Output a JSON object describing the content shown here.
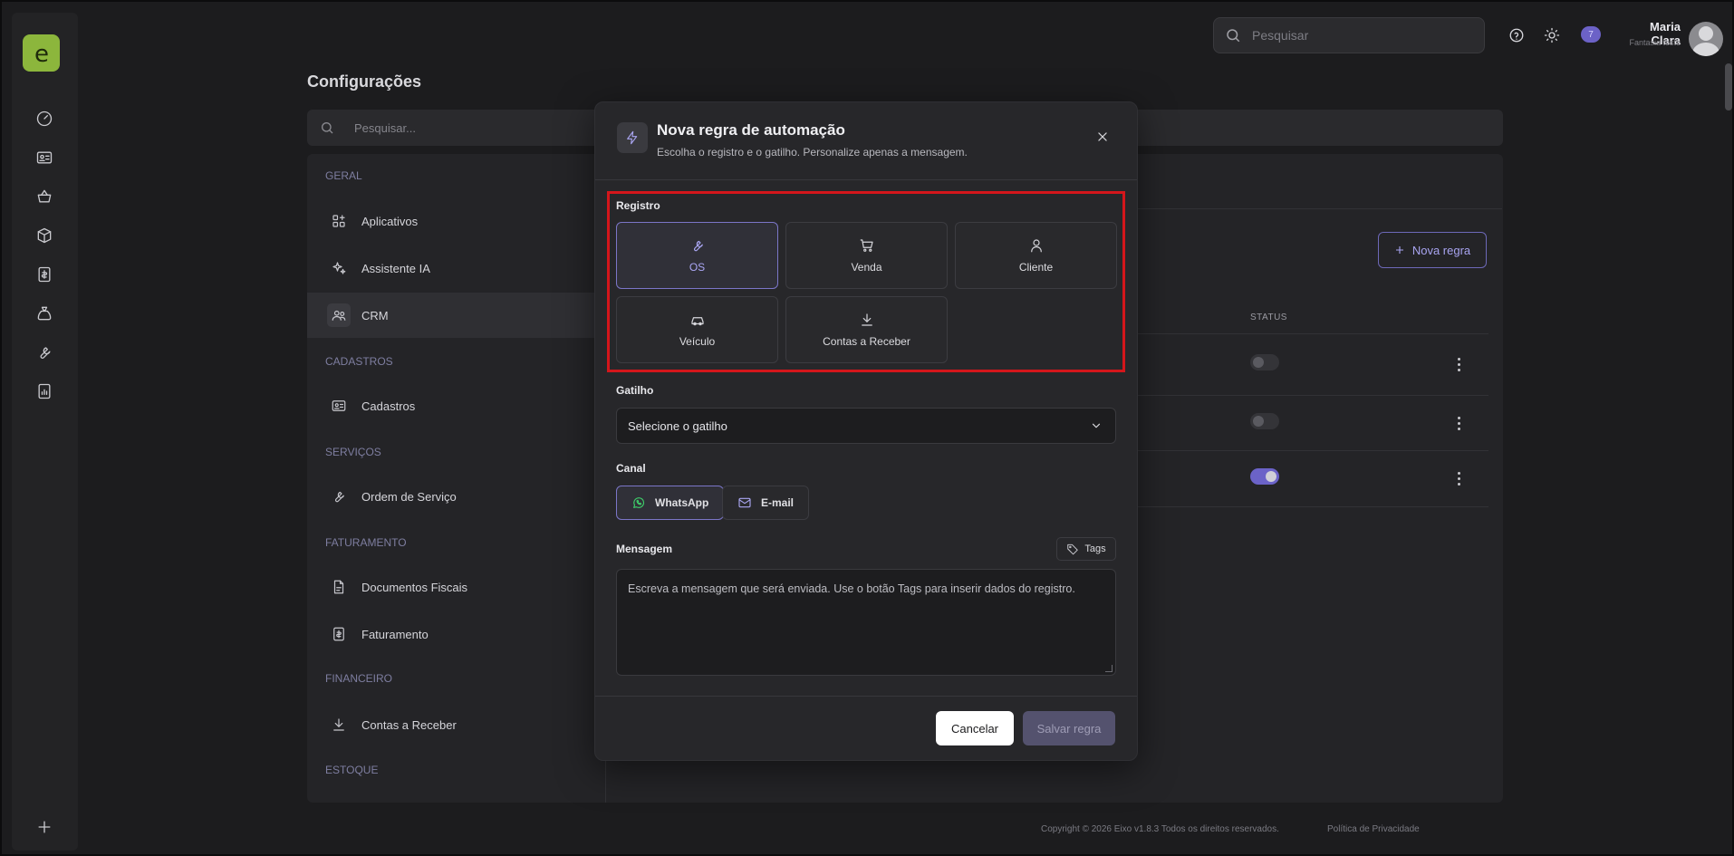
{
  "topbar": {
    "search_placeholder": "Pesquisar",
    "notifications_count": "7",
    "user_name": "Maria Clara",
    "user_company": "Fantasia teste"
  },
  "page": {
    "title": "Configurações",
    "search_placeholder": "Pesquisar..."
  },
  "sidebar": {
    "sections": {
      "geral": "GERAL",
      "cadastros": "CADASTROS",
      "servicos": "SERVIÇOS",
      "faturamento": "FATURAMENTO",
      "financeiro": "FINANCEIRO",
      "estoque": "ESTOQUE"
    },
    "items": {
      "aplicativos": "Aplicativos",
      "assistente": "Assistente IA",
      "crm": "CRM",
      "cadastros": "Cadastros",
      "ordem": "Ordem de Serviço",
      "documentos": "Documentos Fiscais",
      "faturamento": "Faturamento",
      "contas": "Contas a Receber"
    }
  },
  "rules": {
    "new_button": "Nova regra",
    "status_header": "STATUS",
    "rows": [
      {
        "status": "off"
      },
      {
        "status": "off"
      },
      {
        "status": "on"
      }
    ]
  },
  "footer": {
    "copyright": "Copyright © 2026 Eixo v1.8.3 Todos os direitos reservados.",
    "privacy": "Política de Privacidade"
  },
  "modal": {
    "title": "Nova regra de automação",
    "subtitle": "Escolha o registro e o gatilho. Personalize apenas a mensagem.",
    "registro_label": "Registro",
    "registro_options": {
      "os": "OS",
      "venda": "Venda",
      "cliente": "Cliente",
      "veiculo": "Veículo",
      "contas": "Contas a Receber"
    },
    "registro_selected": "OS",
    "gatilho_label": "Gatilho",
    "gatilho_value": "Selecione o gatilho",
    "canal_label": "Canal",
    "canal_whatsapp": "WhatsApp",
    "canal_email": "E-mail",
    "canal_selected": "WhatsApp",
    "mensagem_label": "Mensagem",
    "tags_button": "Tags",
    "mensagem_placeholder": "Escreva a mensagem que será enviada. Use o botão Tags para inserir dados do registro.",
    "cancel_button": "Cancelar",
    "save_button": "Salvar regra"
  },
  "colors": {
    "accent": "#6b63c8",
    "logo": "#8cb63c",
    "highlight": "#d4161b"
  }
}
